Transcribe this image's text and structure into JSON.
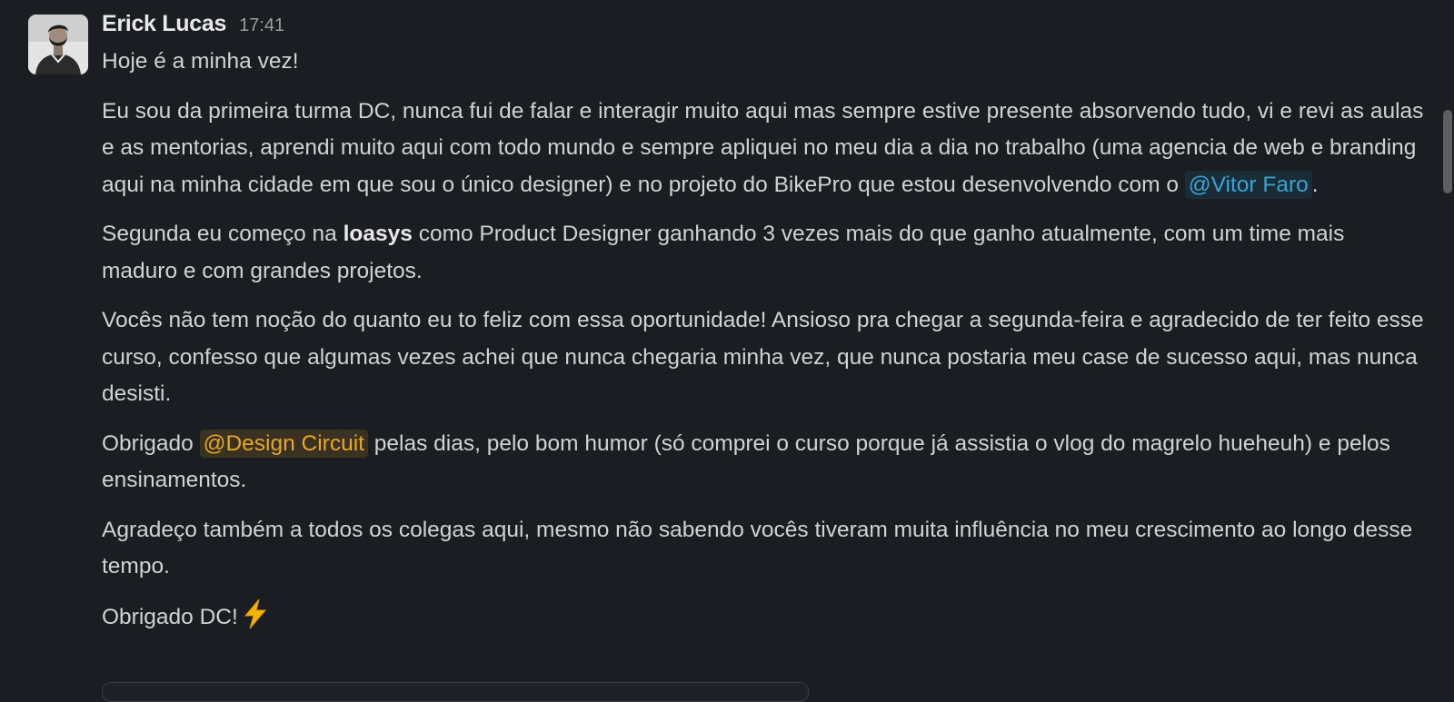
{
  "message": {
    "author": "Erick Lucas",
    "time": "17:41",
    "paragraphs": {
      "p0": "Hoje é a minha vez!",
      "p1": {
        "before": "Eu sou da primeira turma DC, nunca fui de falar e interagir muito aqui mas sempre estive presente absorvendo tudo, vi e revi as aulas e as mentorias, aprendi muito aqui com todo mundo e sempre apliquei no meu dia a dia no trabalho (uma agencia de web e branding aqui na minha cidade em que sou o único designer) e no projeto do BikePro que estou desenvolvendo com o ",
        "mention": "@Vitor Faro",
        "after": "."
      },
      "p2": {
        "before": "Segunda eu começo na ",
        "bold": "loasys",
        "after": " como Product Designer ganhando 3 vezes mais do que ganho atualmente, com um time mais maduro e com grandes projetos."
      },
      "p3": "Vocês não tem noção do quanto eu to feliz com essa oportunidade! Ansioso pra chegar a segunda-feira e agradecido de ter feito esse curso, confesso que algumas vezes achei que nunca chegaria minha vez, que nunca postaria meu case de sucesso aqui, mas nunca desisti.",
      "p4": {
        "before": "Obrigado ",
        "mention": "@Design Circuit",
        "after": " pelas dias, pelo bom humor (só comprei o curso porque já assistia o vlog do magrelo hueheuh) e pelos ensinamentos."
      },
      "p5": "Agradeço também a todos os colegas aqui, mesmo não sabendo vocês tiveram muita influência no meu crescimento ao longo desse tempo.",
      "p6": "Obrigado DC!"
    },
    "emoji": "high-voltage-icon"
  },
  "colors": {
    "background": "#1a1d21",
    "text": "#d1d2d3",
    "mention_user": "#36a4d8",
    "mention_group": "#e8a723",
    "scrollbar": "#5d5f62"
  }
}
